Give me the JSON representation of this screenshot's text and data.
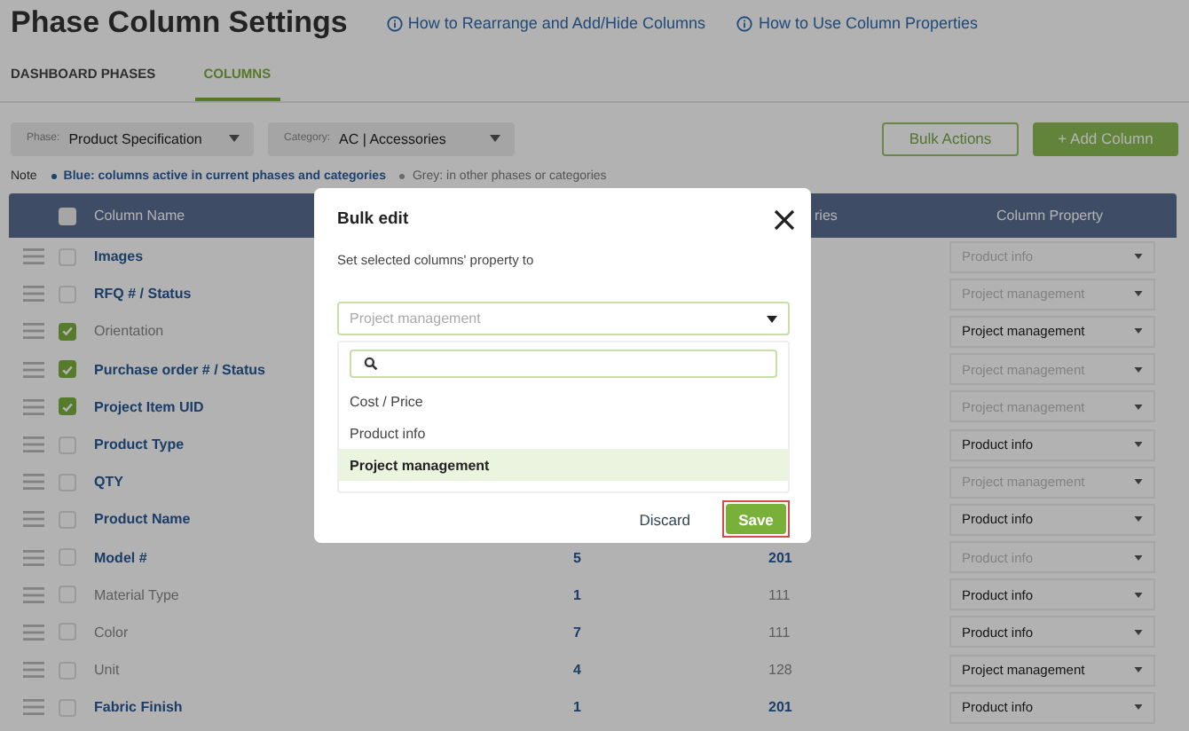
{
  "page": {
    "title": "Phase Column Settings",
    "help_links": [
      "How to Rearrange and Add/Hide Columns",
      "How to Use Column Properties"
    ]
  },
  "tabs": [
    {
      "label": "DASHBOARD PHASES",
      "selected": false
    },
    {
      "label": "COLUMNS",
      "selected": true
    }
  ],
  "filters": [
    {
      "label": "Phase:",
      "value": "Product Specification"
    },
    {
      "label": "Category:",
      "value": "AC | Accessories"
    }
  ],
  "actions": {
    "bulk": "Bulk Actions",
    "add": "+ Add Column"
  },
  "note": {
    "label": "Note",
    "legend": [
      {
        "text": "Blue: columns active in current phases and categories",
        "active": true
      },
      {
        "text": "Grey: in other phases or categories",
        "active": false
      }
    ]
  },
  "table": {
    "columns": [
      "Column Name",
      "ries",
      "Column Property"
    ],
    "select_all": false,
    "rows": [
      {
        "name": "Images",
        "checked": false,
        "active": true,
        "property": "Product info",
        "property_enabled": false
      },
      {
        "name": "RFQ # / Status",
        "checked": false,
        "active": true,
        "property": "Project management",
        "property_enabled": false
      },
      {
        "name": "Orientation",
        "checked": true,
        "active": false,
        "property": "Project management",
        "property_enabled": true
      },
      {
        "name": "Purchase order # / Status",
        "checked": true,
        "active": true,
        "property": "Project management",
        "property_enabled": false
      },
      {
        "name": "Project Item UID",
        "checked": true,
        "active": true,
        "property": "Project management",
        "property_enabled": false
      },
      {
        "name": "Product Type",
        "checked": false,
        "active": true,
        "property": "Product info",
        "property_enabled": true
      },
      {
        "name": "QTY",
        "checked": false,
        "active": true,
        "property": "Project management",
        "property_enabled": false
      },
      {
        "name": "Product Name",
        "checked": false,
        "active": true,
        "property": "Product info",
        "property_enabled": true
      },
      {
        "name": "Model #",
        "checked": false,
        "active": true,
        "phases": "5",
        "categories": "201",
        "categories_active": true,
        "property": "Product info",
        "property_enabled": false
      },
      {
        "name": "Material Type",
        "checked": false,
        "active": false,
        "phases": "1",
        "categories": "111",
        "categories_active": false,
        "property": "Product info",
        "property_enabled": true
      },
      {
        "name": "Color",
        "checked": false,
        "active": false,
        "phases": "7",
        "categories": "111",
        "categories_active": false,
        "property": "Product info",
        "property_enabled": true
      },
      {
        "name": "Unit",
        "checked": false,
        "active": false,
        "phases": "4",
        "categories": "128",
        "categories_active": false,
        "property": "Project management",
        "property_enabled": true
      },
      {
        "name": "Fabric Finish",
        "checked": false,
        "active": true,
        "phases": "1",
        "categories": "201",
        "categories_active": true,
        "property": "Product info",
        "property_enabled": true
      }
    ]
  },
  "modal": {
    "title": "Bulk edit",
    "label": "Set selected columns' property to",
    "select_value": "Project management",
    "options": [
      {
        "label": "Cost / Price",
        "selected": false
      },
      {
        "label": "Product info",
        "selected": false
      },
      {
        "label": "Project management",
        "selected": true
      }
    ],
    "discard": "Discard",
    "save": "Save"
  }
}
